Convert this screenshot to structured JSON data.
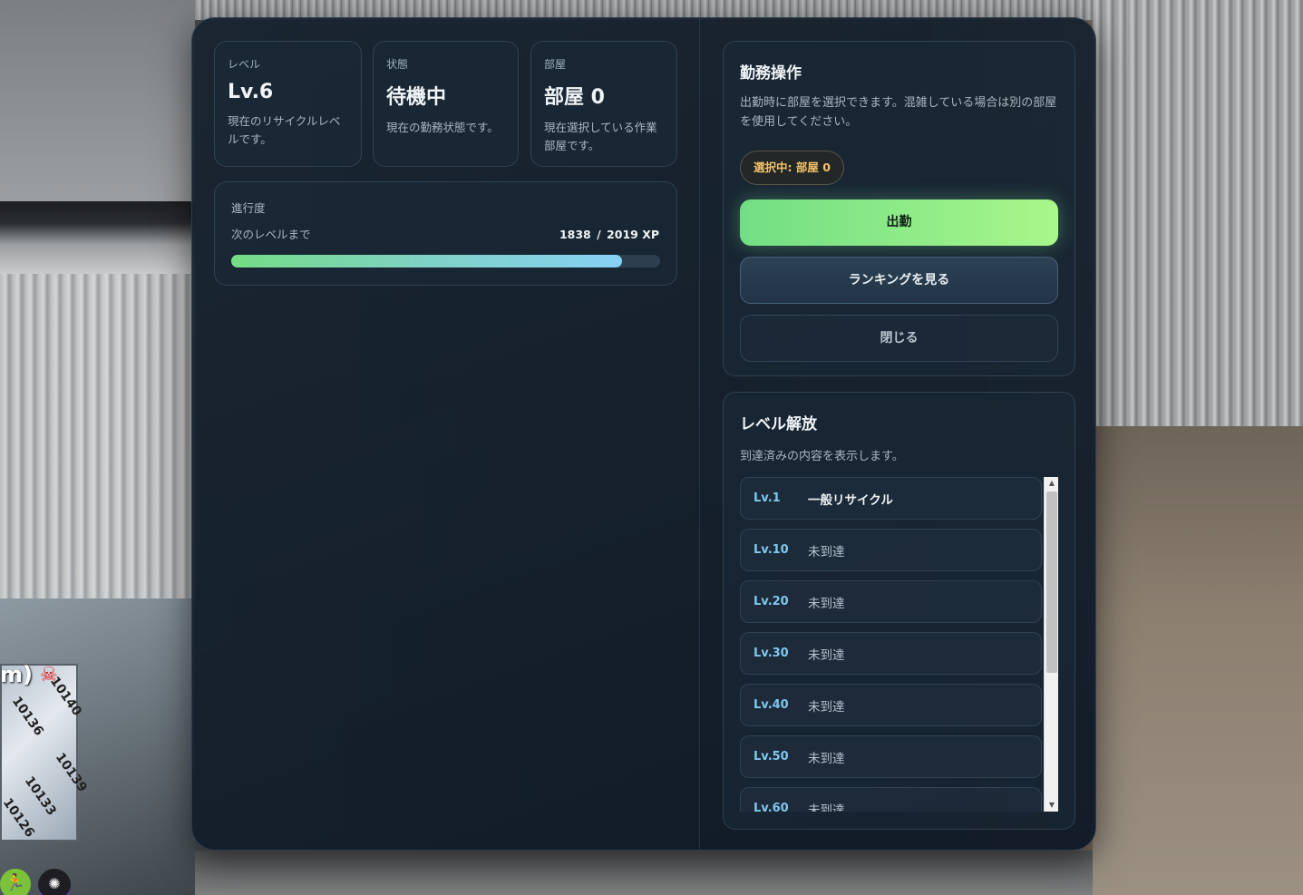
{
  "hud": {
    "overhead_text": "m)",
    "skull_icon": "skull-icon",
    "map_labels": [
      "10140",
      "10136",
      "10139",
      "10133",
      "10126"
    ]
  },
  "stats": {
    "level": {
      "label": "レベル",
      "value": "Lv.6",
      "desc": "現在のリサイクルレベルです。"
    },
    "status": {
      "label": "状態",
      "value": "待機中",
      "desc": "現在の勤務状態です。"
    },
    "room": {
      "label": "部屋",
      "value": "部屋 0",
      "desc": "現在選択している作業部屋です。"
    }
  },
  "progress": {
    "label": "進行度",
    "sub": "次のレベルまで",
    "current": "1838",
    "separator": "/",
    "max": "2019 XP",
    "fraction": 0.9104
  },
  "ops": {
    "title": "勤務操作",
    "desc": "出勤時に部屋を選択できます。混雑している場合は別の部屋を使用してください。",
    "selected_chip": "選択中: 部屋 0",
    "start_button": "出勤",
    "ranking_button": "ランキングを見る",
    "close_button": "閉じる"
  },
  "unlocks": {
    "title": "レベル解放",
    "desc": "到達済みの内容を表示します。",
    "items": [
      {
        "level": "Lv.1",
        "text": "一般リサイクル",
        "unlocked": true
      },
      {
        "level": "Lv.10",
        "text": "未到達",
        "unlocked": false
      },
      {
        "level": "Lv.20",
        "text": "未到達",
        "unlocked": false
      },
      {
        "level": "Lv.30",
        "text": "未到達",
        "unlocked": false
      },
      {
        "level": "Lv.40",
        "text": "未到達",
        "unlocked": false
      },
      {
        "level": "Lv.50",
        "text": "未到達",
        "unlocked": false
      },
      {
        "level": "Lv.60",
        "text": "未到達",
        "unlocked": false
      }
    ]
  },
  "colors": {
    "accent_green": "#72de84",
    "accent_blue": "#7fc7ef",
    "chip_text": "#f4c36a"
  }
}
